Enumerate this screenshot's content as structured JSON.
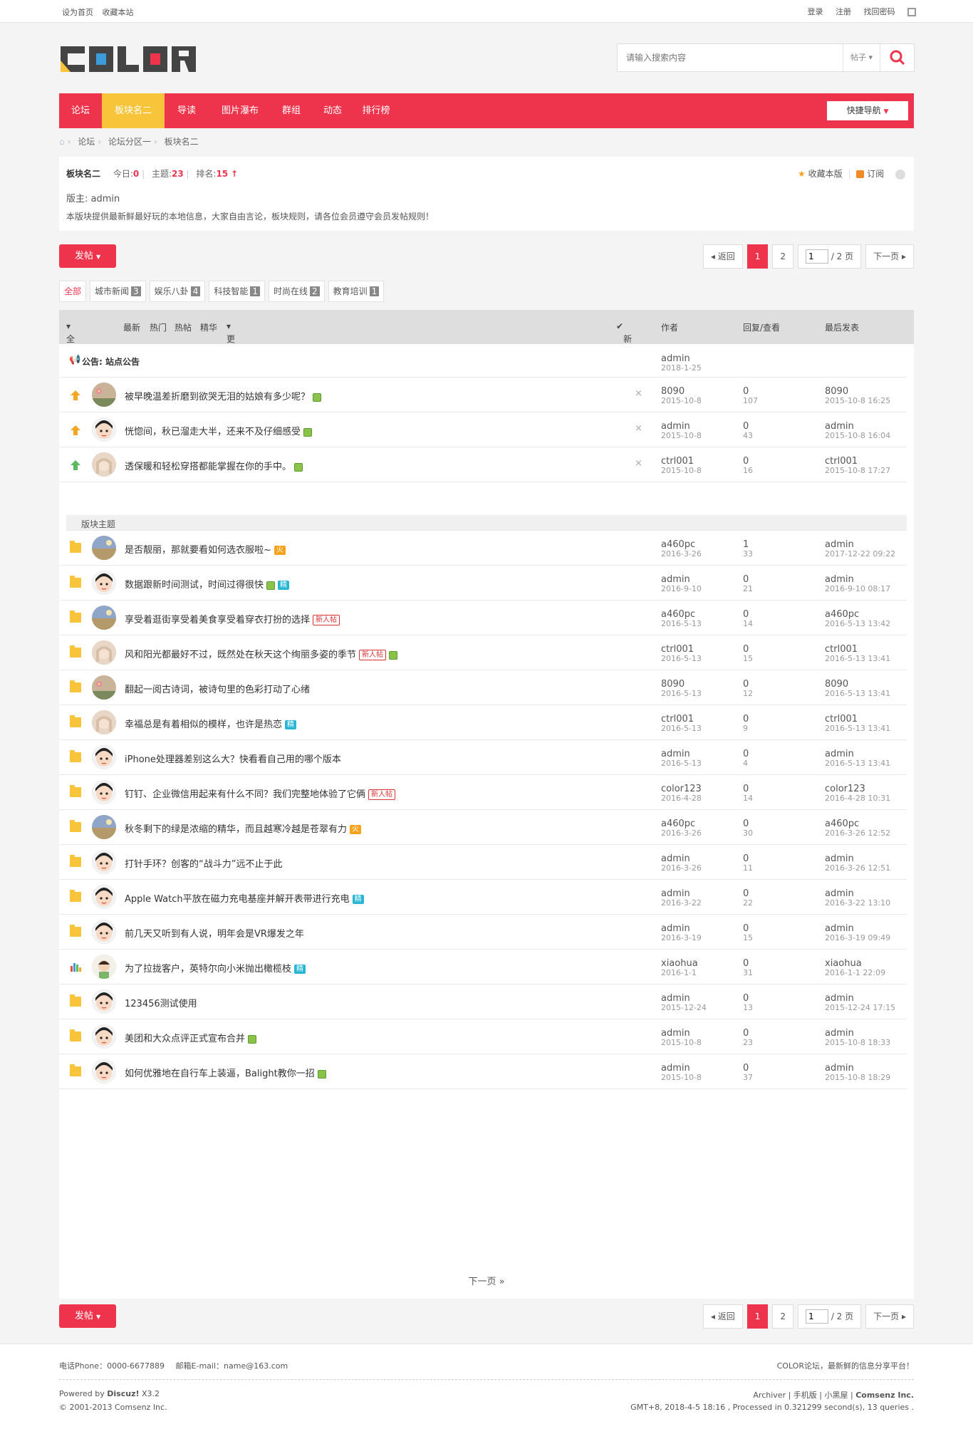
{
  "topbar": {
    "set_home": "设为首页",
    "bookmark": "收藏本站",
    "login": "登录",
    "register": "注册",
    "forgot": "找回密码"
  },
  "search": {
    "placeholder": "请输入搜索内容",
    "type": "帖子"
  },
  "nav": {
    "items": [
      "论坛",
      "板块名二",
      "导读",
      "图片瀑布",
      "群组",
      "动态",
      "排行榜"
    ],
    "active": 1,
    "quick": "快捷导航"
  },
  "breadcrumb": [
    "论坛",
    "论坛分区一",
    "板块名二"
  ],
  "forum": {
    "name": "板块名二",
    "today_label": "今日:",
    "today": "0",
    "threads_label": "主题:",
    "threads": "23",
    "rank_label": "排名:",
    "rank": "15",
    "fav": "收藏本版",
    "rss": "订阅",
    "moderator": "版主: admin",
    "description": "本版块提供最新鲜最好玩的本地信息，大家自由言论，板块规则，请各位会员遵守会员发帖规则！"
  },
  "post_button": "发帖",
  "pager": {
    "back": "返回",
    "pages": [
      "1",
      "2"
    ],
    "current": "1",
    "input": "1",
    "total": "/ 2 页",
    "next": "下一页"
  },
  "types": [
    {
      "label": "全部",
      "count": ""
    },
    {
      "label": "城市新闻",
      "count": "3"
    },
    {
      "label": "娱乐八卦",
      "count": "4"
    },
    {
      "label": "科技智能",
      "count": "1"
    },
    {
      "label": "时尚在线",
      "count": "2"
    },
    {
      "label": "教育培训",
      "count": "1"
    }
  ],
  "thead": {
    "all": "全部主题",
    "latest": "最新",
    "hot": "热门",
    "hotspot": "热帖",
    "digest": "精华",
    "more": "更多",
    "newwin": "新窗",
    "author": "作者",
    "replies": "回复/查看",
    "lastpost": "最后发表"
  },
  "announcement": {
    "label": "公告: 站点公告",
    "author": "admin",
    "date": "2018-1-25"
  },
  "sticky": [
    {
      "title": "被早晚温差折磨到欲哭无泪的姑娘有多少呢？",
      "author": "8090",
      "date": "2015-10-8",
      "replies": "0",
      "views": "107",
      "last_user": "8090",
      "last_date": "2015-10-8 16:25",
      "tags": [
        "img"
      ],
      "icon": "orange",
      "avatar": "flower"
    },
    {
      "title": "恍惚间，秋已溜走大半，还来不及仔细感受",
      "author": "admin",
      "date": "2015-10-8",
      "replies": "0",
      "views": "43",
      "last_user": "admin",
      "last_date": "2015-10-8 16:04",
      "tags": [
        "img"
      ],
      "icon": "orange",
      "avatar": "boy"
    },
    {
      "title": "透保暖和轻松穿搭都能掌握在你的手中。",
      "author": "ctrl001",
      "date": "2015-10-8",
      "replies": "0",
      "views": "16",
      "last_user": "ctrl001",
      "last_date": "2015-10-8 17:27",
      "tags": [
        "img"
      ],
      "icon": "green",
      "avatar": "girl"
    }
  ],
  "separator": "版块主题",
  "threads": [
    {
      "title": "是否靓丽，那就要看如何选衣服啦~",
      "author": "a460pc",
      "date": "2016-3-26",
      "replies": "1",
      "views": "33",
      "last_user": "admin",
      "last_date": "2017-12-22 09:22",
      "tags": [
        "fire"
      ],
      "avatar": "scene"
    },
    {
      "title": "数据跟新时间测试，时间过得很快",
      "author": "admin",
      "date": "2016-9-10",
      "replies": "0",
      "views": "21",
      "last_user": "admin",
      "last_date": "2016-9-10 08:17",
      "tags": [
        "img",
        "jing"
      ],
      "avatar": "boy"
    },
    {
      "title": "享受着逛街享受着美食享受着穿衣打扮的选择",
      "author": "a460pc",
      "date": "2016-5-13",
      "replies": "0",
      "views": "14",
      "last_user": "a460pc",
      "last_date": "2016-5-13 13:42",
      "tags": [
        "new"
      ],
      "avatar": "scene"
    },
    {
      "title": "风和阳光都最好不过，既然处在秋天这个绚丽多姿的季节",
      "author": "ctrl001",
      "date": "2016-5-13",
      "replies": "0",
      "views": "15",
      "last_user": "ctrl001",
      "last_date": "2016-5-13 13:41",
      "tags": [
        "new",
        "img"
      ],
      "avatar": "girl"
    },
    {
      "title": "翻起一阅古诗词，被诗句里的色彩打动了心绪",
      "author": "8090",
      "date": "2016-5-13",
      "replies": "0",
      "views": "12",
      "last_user": "8090",
      "last_date": "2016-5-13 13:41",
      "tags": [],
      "avatar": "flower"
    },
    {
      "title": "幸福总是有着相似的模样，也许是热恋",
      "author": "ctrl001",
      "date": "2016-5-13",
      "replies": "0",
      "views": "9",
      "last_user": "ctrl001",
      "last_date": "2016-5-13 13:41",
      "tags": [
        "jing"
      ],
      "avatar": "girl"
    },
    {
      "title": "iPhone处理器差别这么大？快看看自己用的哪个版本",
      "author": "admin",
      "date": "2016-5-13",
      "replies": "0",
      "views": "4",
      "last_user": "admin",
      "last_date": "2016-5-13 13:41",
      "tags": [],
      "avatar": "boy"
    },
    {
      "title": "钉钉、企业微信用起来有什么不同？我们完整地体验了它俩",
      "author": "color123",
      "date": "2016-4-28",
      "replies": "0",
      "views": "14",
      "last_user": "color123",
      "last_date": "2016-4-28 10:31",
      "tags": [
        "new"
      ],
      "avatar": "boy"
    },
    {
      "title": "秋冬剩下的绿是浓缩的精华，而且越寒冷越是苍翠有力",
      "author": "a460pc",
      "date": "2016-3-26",
      "replies": "0",
      "views": "30",
      "last_user": "a460pc",
      "last_date": "2016-3-26 12:52",
      "tags": [
        "fire"
      ],
      "avatar": "scene"
    },
    {
      "title": "打针手环？创客的“战斗力”远不止于此",
      "author": "admin",
      "date": "2016-3-26",
      "replies": "0",
      "views": "11",
      "last_user": "admin",
      "last_date": "2016-3-26 12:51",
      "tags": [],
      "avatar": "boy"
    },
    {
      "title": "Apple Watch平放在磁力充电基座并解开表带进行充电",
      "author": "admin",
      "date": "2016-3-22",
      "replies": "0",
      "views": "22",
      "last_user": "admin",
      "last_date": "2016-3-22 13:10",
      "tags": [
        "jing"
      ],
      "avatar": "boy"
    },
    {
      "title": "前几天又听到有人说，明年会是VR爆发之年",
      "author": "admin",
      "date": "2016-3-19",
      "replies": "0",
      "views": "15",
      "last_user": "admin",
      "last_date": "2016-3-19 09:49",
      "tags": [],
      "avatar": "boy"
    },
    {
      "title": "为了拉拢客户，英特尔向小米抛出橄榄枝",
      "author": "xiaohua",
      "date": "2016-1-1",
      "replies": "0",
      "views": "31",
      "last_user": "xiaohua",
      "last_date": "2016-1-1 22:09",
      "tags": [
        "jing"
      ],
      "avatar": "kid",
      "icon": "poll"
    },
    {
      "title": "123456测试使用",
      "author": "admin",
      "date": "2015-12-24",
      "replies": "0",
      "views": "13",
      "last_user": "admin",
      "last_date": "2015-12-24 17:15",
      "tags": [],
      "avatar": "boy"
    },
    {
      "title": "美团和大众点评正式宣布合并",
      "author": "admin",
      "date": "2015-10-8",
      "replies": "0",
      "views": "23",
      "last_user": "admin",
      "last_date": "2015-10-8 18:33",
      "tags": [
        "img"
      ],
      "avatar": "boy"
    },
    {
      "title": "如何优雅地在自行车上装逼，Balight教你一招",
      "author": "admin",
      "date": "2015-10-8",
      "replies": "0",
      "views": "37",
      "last_user": "admin",
      "last_date": "2015-10-8 18:29",
      "tags": [
        "img"
      ],
      "avatar": "boy"
    }
  ],
  "tag_text": {
    "new": "新人帖",
    "fire": "火",
    "jing": "精"
  },
  "next_page": "下一页 »",
  "footer": {
    "phone": "电话Phone：0000-6677889",
    "email": "邮箱E-mail：name@163.com",
    "slogan": "COLOR论坛，最新鲜的信息分享平台！",
    "powered": "Powered by",
    "discuz": "Discuz!",
    "version": "X3.2",
    "copy": "© 2001-2013 Comsenz Inc.",
    "links": [
      "Archiver",
      "手机版",
      "小黑屋"
    ],
    "company": "Comsenz Inc.",
    "stat": "GMT+8, 2018-4-5 18:16 , Processed in 0.321299 second(s), 13 queries ."
  },
  "colors": {
    "accent": "#ee344d",
    "active_nav": "#f8c43a"
  }
}
